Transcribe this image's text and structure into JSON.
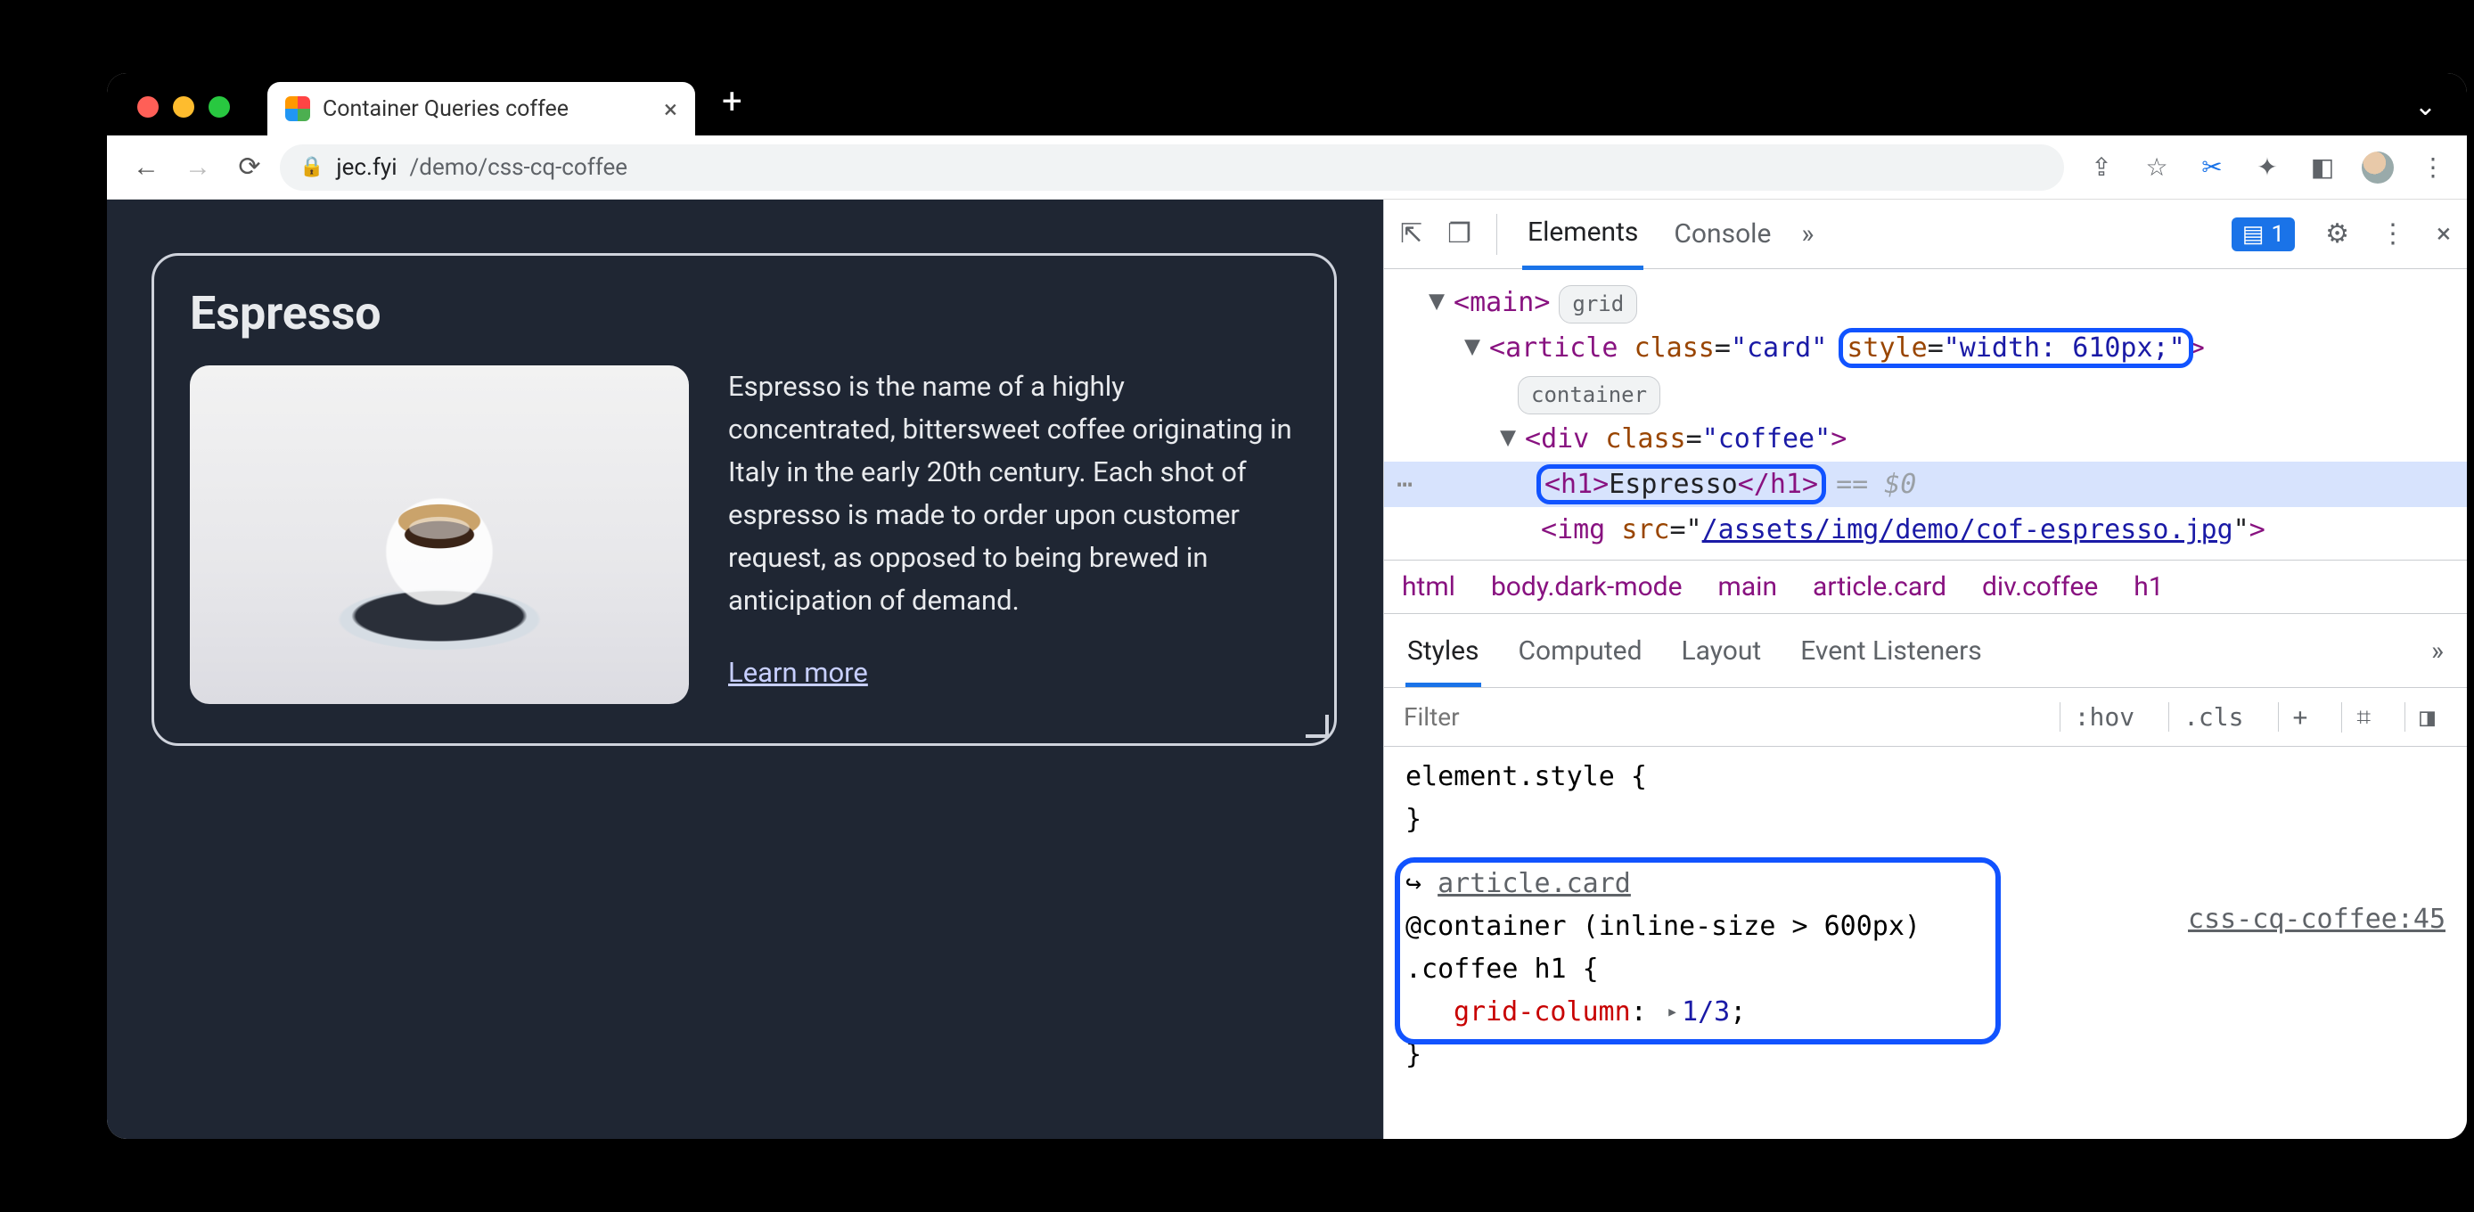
{
  "browser": {
    "tab_title": "Container Queries coffee",
    "url_host": "jec.fyi",
    "url_path": "/demo/css-cq-coffee"
  },
  "page": {
    "card_title": "Espresso",
    "card_text": "Espresso is the name of a highly concentrated, bittersweet coffee originating in Italy in the early 20th century. Each shot of espresso is made to order upon customer request, as opposed to being brewed in anticipation of demand.",
    "learn_more": "Learn more"
  },
  "devtools": {
    "tabs": {
      "elements": "Elements",
      "console": "Console"
    },
    "issues_count": "1",
    "dom": {
      "main_tag": "main",
      "main_badge": "grid",
      "article_open": "article",
      "article_class_attr": "class",
      "article_class_val": "\"card\"",
      "article_style_attr": "style",
      "article_style_val": "\"width: 610px;\"",
      "container_badge": "container",
      "div_tag": "div",
      "div_class_attr": "class",
      "div_class_val": "\"coffee\"",
      "h1_open": "<h1>",
      "h1_text": "Espresso",
      "h1_close": "</h1>",
      "eq0": "== $0",
      "img_tag": "img",
      "img_src_attr": "src",
      "img_src_val": "/assets/img/demo/cof-espresso.jpg"
    },
    "crumbs": [
      "html",
      "body.dark-mode",
      "main",
      "article.card",
      "div.coffee",
      "h1"
    ],
    "styles_tabs": {
      "styles": "Styles",
      "computed": "Computed",
      "layout": "Layout",
      "event": "Event Listeners"
    },
    "filter_placeholder": "Filter",
    "filter_right": {
      "hov": ":hov",
      "cls": ".cls",
      "plus": "+"
    },
    "rules": {
      "element_style": "element.style {",
      "element_style_close": "}",
      "container_link_arrow": "↪",
      "container_link": "article.card",
      "container_query": "@container (inline-size > 600px)",
      "selector": ".coffee h1 {",
      "src": "css-cq-coffee:45",
      "prop_name": "grid-column",
      "prop_val": "1/3",
      "close": "}"
    }
  }
}
